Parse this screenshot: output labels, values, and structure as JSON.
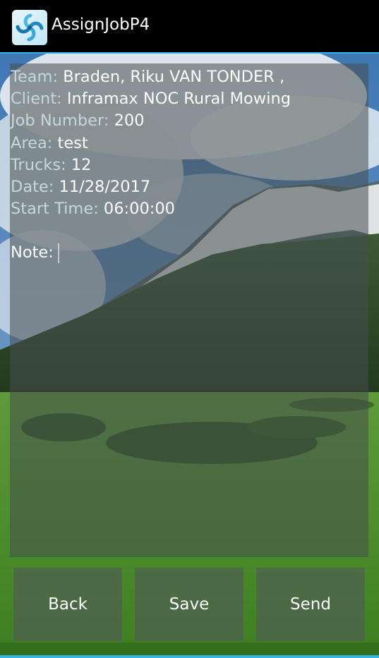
{
  "app": {
    "title": "AssignJobP4",
    "icon": "swirl-app-icon",
    "accent_color": "#33b5e5"
  },
  "job": {
    "team_label": "Team:",
    "team_value": "Braden, Riku VAN TONDER  ,",
    "client_label": "Client:",
    "client_value": "Inframax NOC Rural Mowing",
    "job_number_label": "Job Number:",
    "job_number_value": "200",
    "area_label": "Area:",
    "area_value": "test",
    "trucks_label": "Trucks:",
    "trucks_value": "12",
    "date_label": "Date:",
    "date_value": "11/28/2017",
    "start_time_label": "Start Time:",
    "start_time_value": "06:00:00",
    "note_label": "Note:",
    "note_value": ""
  },
  "buttons": {
    "back": "Back",
    "save": "Save",
    "send": "Send"
  }
}
